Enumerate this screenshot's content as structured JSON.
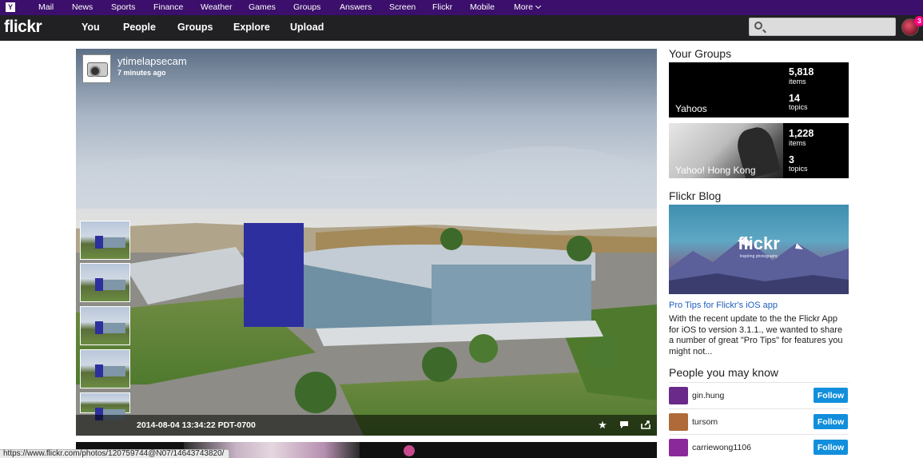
{
  "yahoo_bar": {
    "logo": "Y",
    "items": [
      "Mail",
      "News",
      "Sports",
      "Finance",
      "Weather",
      "Games",
      "Groups",
      "Answers",
      "Screen",
      "Flickr",
      "Mobile"
    ],
    "more_label": "More"
  },
  "flickr_nav": {
    "logo": "flickr",
    "items": [
      "You",
      "People",
      "Groups",
      "Explore",
      "Upload"
    ],
    "search": {
      "value": "",
      "placeholder": ""
    },
    "notification_count": "3"
  },
  "photo": {
    "owner": "ytimelapsecam",
    "posted": "7 minutes ago",
    "date": "2014-08-04 13:34:22 PDT-0700",
    "thumbnail_count": 5,
    "actions": [
      "star-icon",
      "comment-icon",
      "share-icon"
    ]
  },
  "status_url": "https://www.flickr.com/photos/120759744@N07/14643743820/",
  "sidebar": {
    "your_groups_title": "Your Groups",
    "groups": [
      {
        "name": "Yahoos",
        "items": "5,818",
        "items_label": "items",
        "topics": "14",
        "topics_label": "topics"
      },
      {
        "name": "Yahoo! Hong Kong",
        "items": "1,228",
        "items_label": "items",
        "topics": "3",
        "topics_label": "topics"
      }
    ],
    "blog_title": "Flickr Blog",
    "blog_image_logo": "flickr",
    "blog_image_tagline": "Inspiring photography",
    "blog_link": "Pro Tips for Flickr's iOS app",
    "blog_text": "With the recent update to the the Flickr App for iOS to version 3.1.1., we wanted to share a number of great \"Pro Tips\" for features you might not...",
    "people_title": "People you may know",
    "people": [
      {
        "name": "gin.hung",
        "follow_label": "Follow",
        "avatar_color": "#6a2a8a"
      },
      {
        "name": "tursom",
        "follow_label": "Follow",
        "avatar_color": "#b06a3a"
      },
      {
        "name": "carriewong1106",
        "follow_label": "Follow",
        "avatar_color": "#8a2a9a"
      }
    ]
  }
}
